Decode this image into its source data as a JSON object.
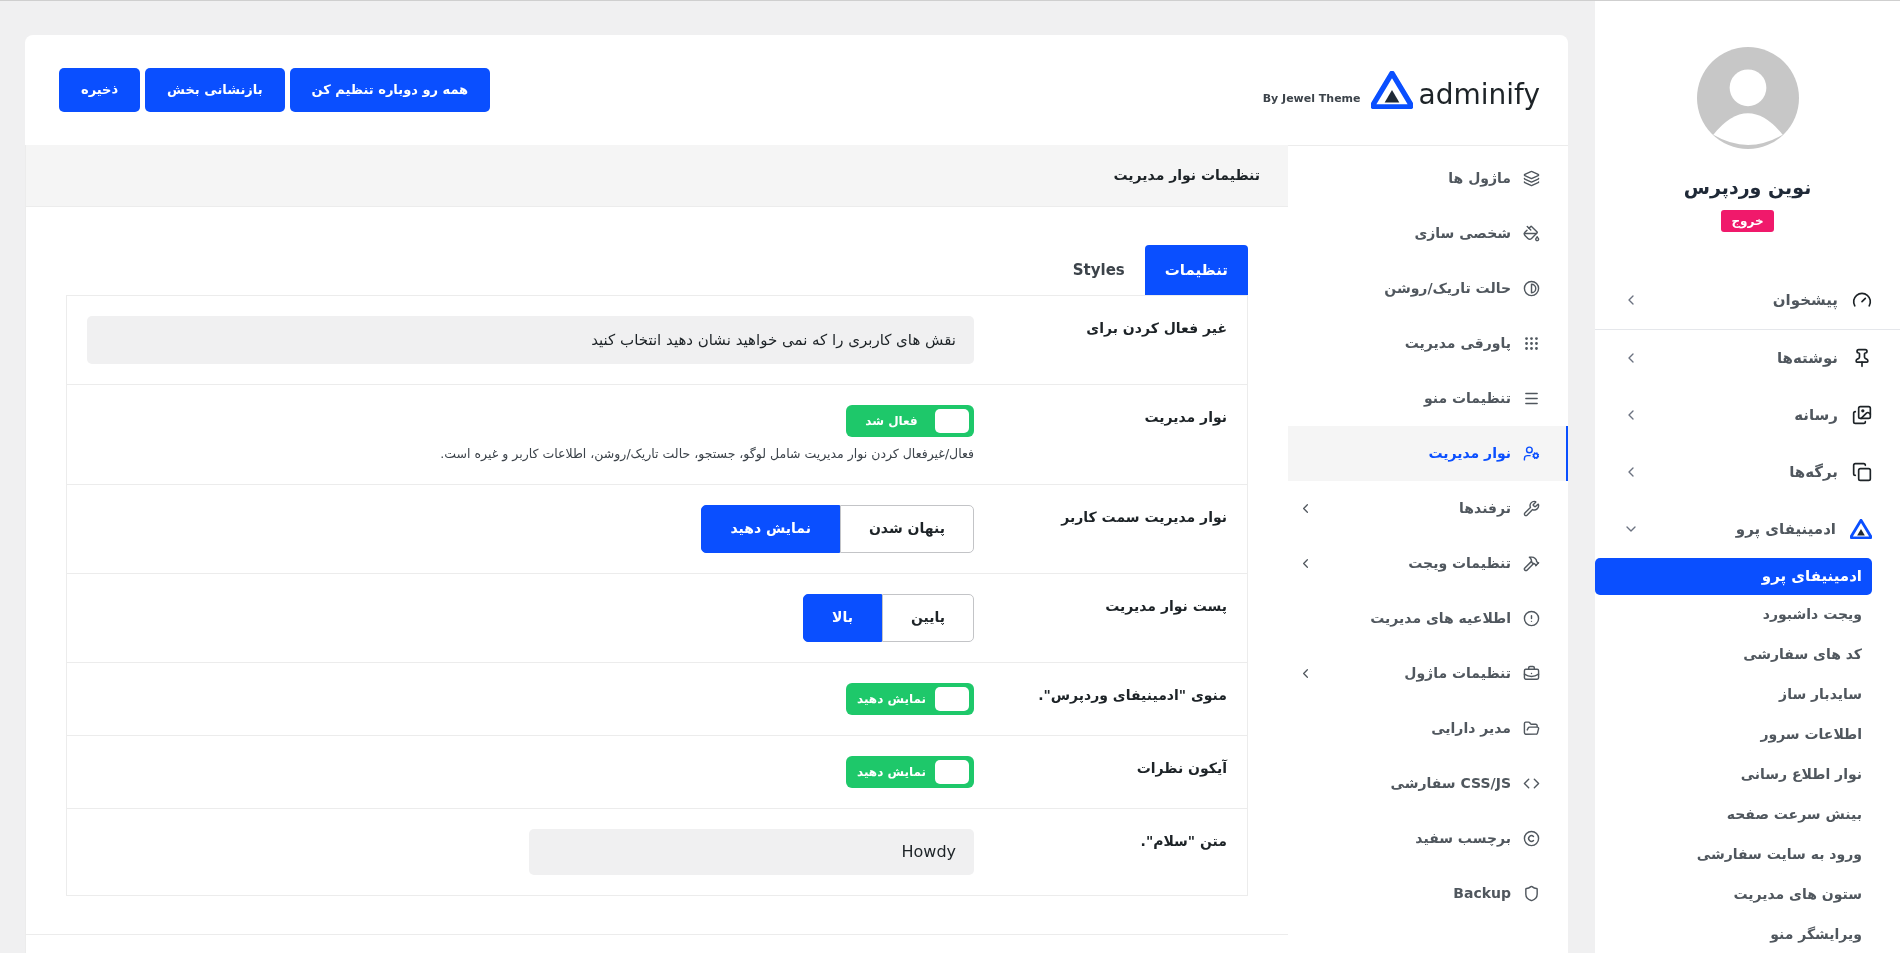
{
  "sidebar": {
    "user": {
      "name": "نوین وردپرس",
      "logout": "خروج"
    },
    "items": [
      {
        "label": "پیشخوان",
        "expanded": false
      },
      {
        "label": "نوشته‌ها",
        "expanded": false
      },
      {
        "label": "رسانه",
        "expanded": false
      },
      {
        "label": "برگه‌ها",
        "expanded": false
      },
      {
        "label": "ادمینیفای پرو",
        "expanded": true,
        "children": [
          {
            "label": "ادمینیفای پرو",
            "selected": true
          },
          {
            "label": "ویجت داشبورد",
            "selected": false
          },
          {
            "label": "کد های سفارشی",
            "selected": false
          },
          {
            "label": "سایدبار ساز",
            "selected": false
          },
          {
            "label": "اطلاعات سرور",
            "selected": false
          },
          {
            "label": "نوار اطلاع رسانی",
            "selected": false
          },
          {
            "label": "بینش سرعت صفحه",
            "selected": false
          },
          {
            "label": "ورود به سایت سفارشی",
            "selected": false
          },
          {
            "label": "ستون های مدیریت",
            "selected": false
          },
          {
            "label": "ویرایشگر منو",
            "selected": false
          }
        ]
      }
    ]
  },
  "header": {
    "logo": "adminify",
    "byline": "By Jewel Theme",
    "buttons": [
      "همه رو دوباره تنظیم کن",
      "بازنشانی بخش",
      "ذخیره"
    ]
  },
  "nav": [
    {
      "label": "ماژول ها",
      "selected": false,
      "expandable": false
    },
    {
      "label": "شخصی سازی",
      "selected": false,
      "expandable": false
    },
    {
      "label": "حالت تاریک/روشن",
      "selected": false,
      "expandable": false
    },
    {
      "label": "پاورقی مدیریت",
      "selected": false,
      "expandable": false
    },
    {
      "label": "تنظیمات منو",
      "selected": false,
      "expandable": false
    },
    {
      "label": "نوار مدیریت",
      "selected": true,
      "expandable": false
    },
    {
      "label": "ترفندها",
      "selected": false,
      "expandable": true
    },
    {
      "label": "تنظیمات ویجت",
      "selected": false,
      "expandable": true
    },
    {
      "label": "اطلاعیه های مدیریت",
      "selected": false,
      "expandable": false
    },
    {
      "label": "تنظیمات ماژول",
      "selected": false,
      "expandable": true
    },
    {
      "label": "مدیر دارایی",
      "selected": false,
      "expandable": false
    },
    {
      "label": "CSS/JS سفارشی",
      "selected": false,
      "expandable": false
    },
    {
      "label": "برچسب سفید",
      "selected": false,
      "expandable": false
    },
    {
      "label": "Backup",
      "selected": false,
      "expandable": false
    }
  ],
  "section_title": "تنظیمات نوار مدیریت",
  "tabs": [
    {
      "label": "تنظیمات",
      "selected": true
    },
    {
      "label": "Styles",
      "selected": false
    }
  ],
  "settings": [
    {
      "kind": "select",
      "label": "غیر فعال کردن برای",
      "placeholder": "نقش های کاربری را که نمی خواهید نشان دهید انتخاب کنید"
    },
    {
      "kind": "toggle",
      "label": "نوار مدیریت",
      "on": true,
      "text": "فعال شد",
      "description": "فعال/غیرفعال کردن نوار مدیریت شامل لوگو، جستجو، حالت تاریک/روشن، اطلاعات کاربر و غیره است."
    },
    {
      "kind": "segmented",
      "label": "نوار مدیریت سمت کاربر",
      "options": [
        {
          "label": "پنهان شدن",
          "selected": false
        },
        {
          "label": "نمایش دهید",
          "selected": true
        }
      ]
    },
    {
      "kind": "segmented",
      "label": "پست نوار مدیریت",
      "options": [
        {
          "label": "پایین",
          "selected": false
        },
        {
          "label": "بالا",
          "selected": true
        }
      ]
    },
    {
      "kind": "toggle",
      "label": "منوی \"ادمینیفای وردپرس\".",
      "on": true,
      "text": "نمایش دهید"
    },
    {
      "kind": "toggle",
      "label": "آیکون نظرات",
      "on": true,
      "text": "نمایش دهید"
    },
    {
      "kind": "input",
      "label": "متن \"سلام\".",
      "value": "Howdy"
    }
  ]
}
